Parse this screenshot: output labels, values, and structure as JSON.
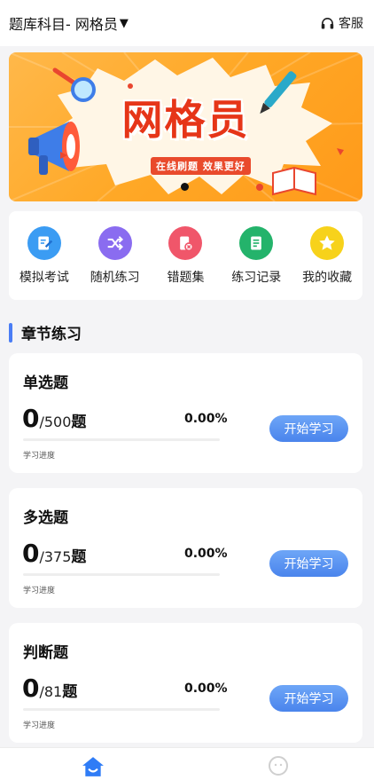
{
  "header": {
    "subject_label": "题库科目- 网格员",
    "caret": "▼",
    "service_label": "客服"
  },
  "banner": {
    "title": "网格员",
    "subtitle": "在线刷题  效果更好",
    "slide_count": 1,
    "active_slide": 1
  },
  "menu": {
    "items": [
      {
        "label": "模拟考试",
        "icon": "exam-icon",
        "color": "#3b9cf3"
      },
      {
        "label": "随机练习",
        "icon": "shuffle-icon",
        "color": "#8a6cf0"
      },
      {
        "label": "错题集",
        "icon": "wrong-book-icon",
        "color": "#f0566a"
      },
      {
        "label": "练习记录",
        "icon": "record-icon",
        "color": "#24b36b"
      },
      {
        "label": "我的收藏",
        "icon": "star-icon",
        "color": "#f7d21b"
      }
    ]
  },
  "section": {
    "title": "章节练习"
  },
  "cards": [
    {
      "title": "单选题",
      "done": "0",
      "total": "/500",
      "unit": "题",
      "percent": "0.00%",
      "progress": 0,
      "progress_label": "学习进度",
      "button": "开始学习"
    },
    {
      "title": "多选题",
      "done": "0",
      "total": "/375",
      "unit": "题",
      "percent": "0.00%",
      "progress": 0,
      "progress_label": "学习进度",
      "button": "开始学习"
    },
    {
      "title": "判断题",
      "done": "0",
      "total": "/81",
      "unit": "题",
      "percent": "0.00%",
      "progress": 0,
      "progress_label": "学习进度",
      "button": "开始学习"
    }
  ],
  "bottom_nav": {
    "items": [
      {
        "icon": "home-icon",
        "active": true,
        "color": "#2f7cf6"
      },
      {
        "icon": "profile-icon",
        "active": false,
        "color": "#cfcfcf"
      }
    ]
  },
  "colors": {
    "accent": "#4a7df5",
    "banner_orange": "#ffa826",
    "banner_red": "#e63518"
  }
}
